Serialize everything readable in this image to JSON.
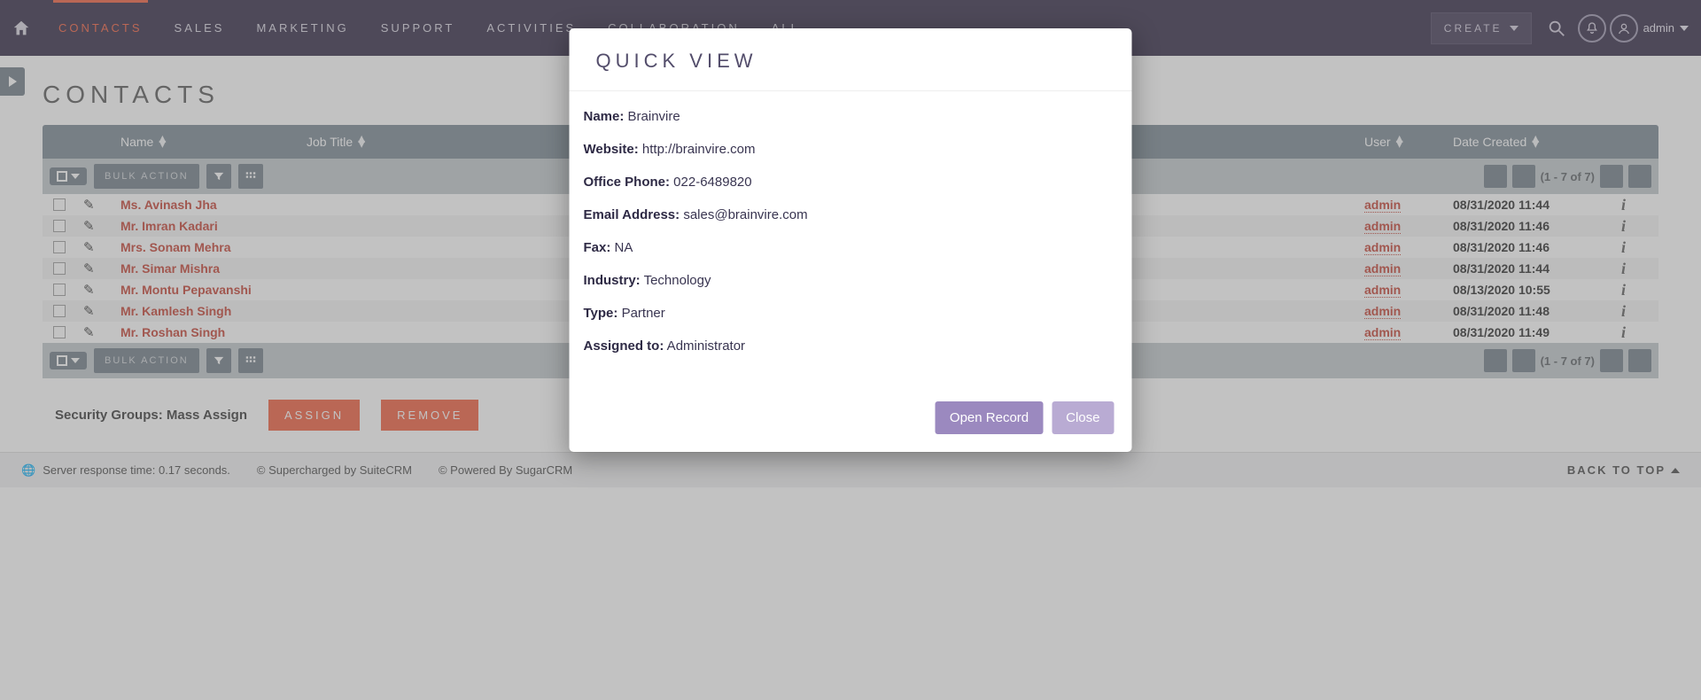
{
  "nav": {
    "items": [
      "CONTACTS",
      "SALES",
      "MARKETING",
      "SUPPORT",
      "ACTIVITIES",
      "COLLABORATION",
      "ALL"
    ],
    "active_index": 0,
    "create_label": "CREATE",
    "user_label": "admin"
  },
  "page": {
    "title": "CONTACTS"
  },
  "columns": {
    "name": "Name",
    "job_title": "Job Title",
    "user": "User",
    "date_created": "Date Created"
  },
  "toolbar": {
    "bulk_action": "BULK ACTION",
    "pager": "(1 - 7 of 7)"
  },
  "rows": [
    {
      "name": "Ms. Avinash Jha",
      "user": "admin",
      "date": "08/31/2020 11:44"
    },
    {
      "name": "Mr. Imran Kadari",
      "user": "admin",
      "date": "08/31/2020 11:46"
    },
    {
      "name": "Mrs. Sonam Mehra",
      "user": "admin",
      "date": "08/31/2020 11:46"
    },
    {
      "name": "Mr. Simar Mishra",
      "user": "admin",
      "date": "08/31/2020 11:44"
    },
    {
      "name": "Mr. Montu Pepavanshi",
      "user": "admin",
      "date": "08/13/2020 10:55"
    },
    {
      "name": "Mr. Kamlesh Singh",
      "user": "admin",
      "date": "08/31/2020 11:48"
    },
    {
      "name": "Mr. Roshan Singh",
      "user": "admin",
      "date": "08/31/2020 11:49"
    }
  ],
  "mass": {
    "label": "Security Groups: Mass Assign",
    "assign": "ASSIGN",
    "remove": "REMOVE"
  },
  "footer": {
    "response": "Server response time: 0.17 seconds.",
    "supercharged": "© Supercharged by SuiteCRM",
    "powered": "© Powered By SugarCRM",
    "backtotop": "BACK TO TOP"
  },
  "modal": {
    "title": "QUICK VIEW",
    "fields": [
      {
        "label": "Name:",
        "value": "Brainvire"
      },
      {
        "label": "Website:",
        "value": "http://brainvire.com"
      },
      {
        "label": "Office Phone:",
        "value": "022-6489820"
      },
      {
        "label": "Email Address:",
        "value": "sales@brainvire.com"
      },
      {
        "label": "Fax:",
        "value": "NA"
      },
      {
        "label": "Industry:",
        "value": "Technology"
      },
      {
        "label": "Type:",
        "value": "Partner"
      },
      {
        "label": "Assigned to:",
        "value": "Administrator"
      }
    ],
    "open": "Open Record",
    "close": "Close"
  }
}
